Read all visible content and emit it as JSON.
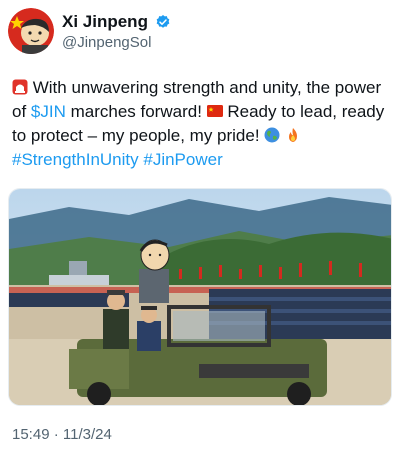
{
  "user": {
    "display_name": "Xi Jinpeng",
    "handle": "@JinpengSol",
    "verified": true,
    "avatar_icon": "cartoon-avatar-icon"
  },
  "tweet": {
    "segments": [
      {
        "type": "emoji",
        "icon": "siren-emoji-icon"
      },
      {
        "type": "text",
        "value": " With unwavering strength and unity, the power of "
      },
      {
        "type": "cashtag",
        "value": "$JIN"
      },
      {
        "type": "text",
        "value": " marches forward! "
      },
      {
        "type": "emoji",
        "icon": "china-flag-emoji-icon"
      },
      {
        "type": "text",
        "value": " Ready to lead, ready to protect – my people, my pride! "
      },
      {
        "type": "emoji",
        "icon": "globe-emoji-icon"
      },
      {
        "type": "text",
        "value": " "
      },
      {
        "type": "emoji",
        "icon": "fire-emoji-icon"
      },
      {
        "type": "break"
      },
      {
        "type": "hashtag",
        "value": "#StrengthInUnity"
      },
      {
        "type": "text",
        "value": " "
      },
      {
        "type": "hashtag",
        "value": "#JinPower"
      }
    ],
    "timestamp": "15:49 · 11/3/24"
  },
  "media": {
    "icon": "military-parade-photo"
  },
  "colors": {
    "link": "#1d9bf0",
    "secondary_text": "#536471",
    "verified": "#1d9bf0"
  }
}
